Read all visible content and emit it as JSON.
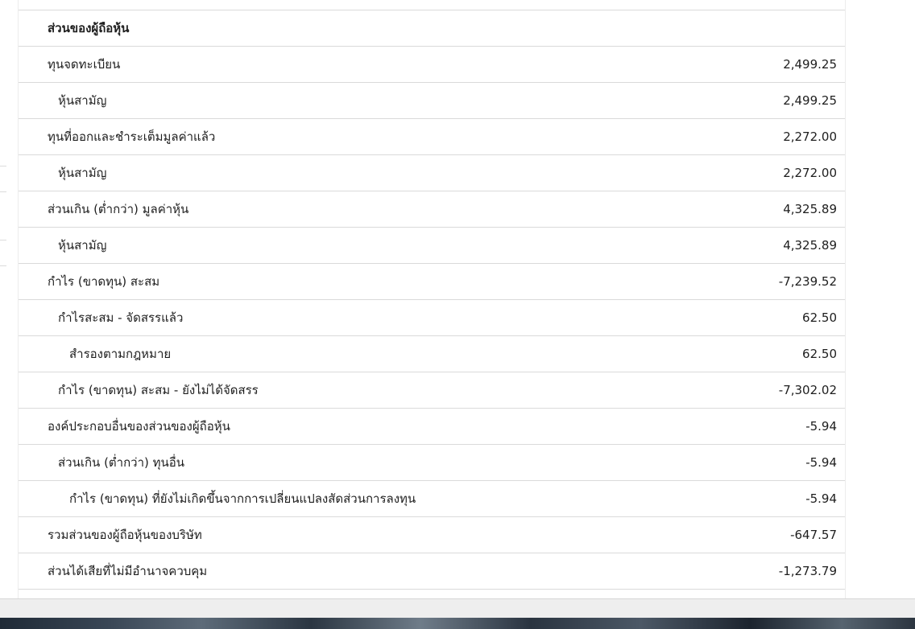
{
  "section": {
    "title": "ส่วนของผู้ถือหุ้น",
    "rows": [
      {
        "label": "ทุนจดทะเบียน",
        "value": "2,499.25"
      },
      {
        "label": "หุ้นสามัญ",
        "value": "2,499.25"
      },
      {
        "label": "ทุนที่ออกและชำระเต็มมูลค่าแล้ว",
        "value": "2,272.00"
      },
      {
        "label": "หุ้นสามัญ",
        "value": "2,272.00"
      },
      {
        "label": "ส่วนเกิน (ต่ำกว่า) มูลค่าหุ้น",
        "value": "4,325.89"
      },
      {
        "label": "หุ้นสามัญ",
        "value": "4,325.89"
      },
      {
        "label": "กำไร (ขาดทุน) สะสม",
        "value": "-7,239.52"
      },
      {
        "label": "กำไรสะสม - จัดสรรแล้ว",
        "value": "62.50"
      },
      {
        "label": "สำรองตามกฎหมาย",
        "value": "62.50"
      },
      {
        "label": "กำไร (ขาดทุน) สะสม - ยังไม่ได้จัดสรร",
        "value": "-7,302.02"
      },
      {
        "label": "องค์ประกอบอื่นของส่วนของผู้ถือหุ้น",
        "value": "-5.94"
      },
      {
        "label": "ส่วนเกิน (ต่ำกว่า) ทุนอื่น",
        "value": "-5.94"
      },
      {
        "label": "กำไร (ขาดทุน) ที่ยังไม่เกิดขึ้นจากการเปลี่ยนแปลงสัดส่วนการลงทุน",
        "value": "-5.94"
      },
      {
        "label": "รวมส่วนของผู้ถือหุ้นของบริษัท",
        "value": "-647.57"
      },
      {
        "label": "ส่วนได้เสียที่ไม่มีอำนาจควบคุม",
        "value": "-1,273.79"
      }
    ]
  }
}
